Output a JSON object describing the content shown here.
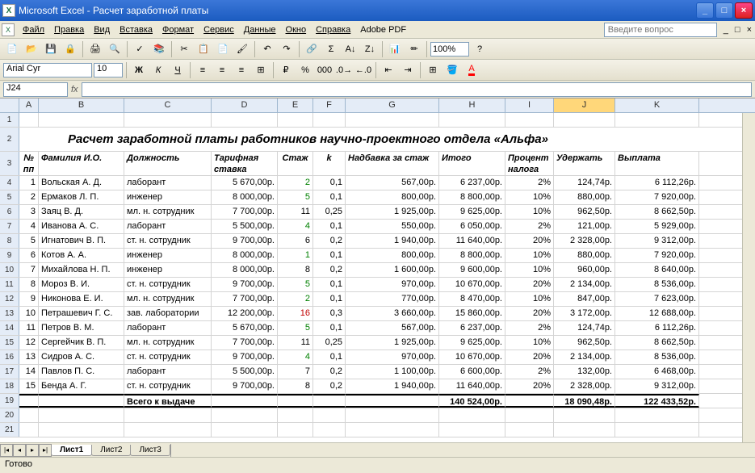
{
  "app": {
    "title": "Microsoft Excel - Расчет заработной платы"
  },
  "menu": {
    "file": "Файл",
    "edit": "Правка",
    "view": "Вид",
    "insert": "Вставка",
    "format": "Формат",
    "tools": "Сервис",
    "data": "Данные",
    "window": "Окно",
    "help": "Справка",
    "adobe": "Adobe PDF"
  },
  "ask": {
    "placeholder": "Введите вопрос"
  },
  "toolbar": {
    "zoom": "100%"
  },
  "format": {
    "font": "Arial Cyr",
    "size": "10"
  },
  "formula": {
    "namebox": "J24",
    "fx": "fx",
    "value": ""
  },
  "columns": [
    "A",
    "B",
    "C",
    "D",
    "E",
    "F",
    "G",
    "H",
    "I",
    "J",
    "K"
  ],
  "sheet": {
    "title": "Расчет заработной платы работников научно-проектного отдела «Альфа»",
    "headers": {
      "n": "№ пп",
      "fio": "Фамилия И.О.",
      "pos": "Должность",
      "rate": "Тарифная ставка",
      "exp": "Стаж",
      "k": "k",
      "bonus": "Надбавка за стаж",
      "total": "Итого",
      "tax": "Процент налога",
      "hold": "Удержать",
      "pay": "Выплата"
    },
    "rows": [
      {
        "n": "1",
        "fio": "Вольская А. Д.",
        "pos": "лаборант",
        "rate": "5 670,00р.",
        "exp": "2",
        "k": "0,1",
        "bonus": "567,00р.",
        "total": "6 237,00р.",
        "tax": "2%",
        "hold": "124,74р.",
        "pay": "6 112,26р."
      },
      {
        "n": "2",
        "fio": "Ермаков Л. П.",
        "pos": "инженер",
        "rate": "8 000,00р.",
        "exp": "5",
        "k": "0,1",
        "bonus": "800,00р.",
        "total": "8 800,00р.",
        "tax": "10%",
        "hold": "880,00р.",
        "pay": "7 920,00р."
      },
      {
        "n": "3",
        "fio": "Заяц В. Д.",
        "pos": "мл. н. сотрудник",
        "rate": "7 700,00р.",
        "exp": "11",
        "k": "0,25",
        "bonus": "1 925,00р.",
        "total": "9 625,00р.",
        "tax": "10%",
        "hold": "962,50р.",
        "pay": "8 662,50р."
      },
      {
        "n": "4",
        "fio": "Иванова А. С.",
        "pos": "лаборант",
        "rate": "5 500,00р.",
        "exp": "4",
        "k": "0,1",
        "bonus": "550,00р.",
        "total": "6 050,00р.",
        "tax": "2%",
        "hold": "121,00р.",
        "pay": "5 929,00р."
      },
      {
        "n": "5",
        "fio": "Игнатович В. П.",
        "pos": "ст. н. сотрудник",
        "rate": "9 700,00р.",
        "exp": "6",
        "k": "0,2",
        "bonus": "1 940,00р.",
        "total": "11 640,00р.",
        "tax": "20%",
        "hold": "2 328,00р.",
        "pay": "9 312,00р."
      },
      {
        "n": "6",
        "fio": "Котов А. А.",
        "pos": "инженер",
        "rate": "8 000,00р.",
        "exp": "1",
        "k": "0,1",
        "bonus": "800,00р.",
        "total": "8 800,00р.",
        "tax": "10%",
        "hold": "880,00р.",
        "pay": "7 920,00р."
      },
      {
        "n": "7",
        "fio": "Михайлова Н. П.",
        "pos": "инженер",
        "rate": "8 000,00р.",
        "exp": "8",
        "k": "0,2",
        "bonus": "1 600,00р.",
        "total": "9 600,00р.",
        "tax": "10%",
        "hold": "960,00р.",
        "pay": "8 640,00р."
      },
      {
        "n": "8",
        "fio": "Мороз В. И.",
        "pos": "ст. н. сотрудник",
        "rate": "9 700,00р.",
        "exp": "5",
        "k": "0,1",
        "bonus": "970,00р.",
        "total": "10 670,00р.",
        "tax": "20%",
        "hold": "2 134,00р.",
        "pay": "8 536,00р."
      },
      {
        "n": "9",
        "fio": "Никонова Е. И.",
        "pos": "мл. н. сотрудник",
        "rate": "7 700,00р.",
        "exp": "2",
        "k": "0,1",
        "bonus": "770,00р.",
        "total": "8 470,00р.",
        "tax": "10%",
        "hold": "847,00р.",
        "pay": "7 623,00р."
      },
      {
        "n": "10",
        "fio": "Петрашевич Г. С.",
        "pos": "зав. лаборатории",
        "rate": "12 200,00р.",
        "exp": "16",
        "k": "0,3",
        "bonus": "3 660,00р.",
        "total": "15 860,00р.",
        "tax": "20%",
        "hold": "3 172,00р.",
        "pay": "12 688,00р."
      },
      {
        "n": "11",
        "fio": "Петров В. М.",
        "pos": "лаборант",
        "rate": "5 670,00р.",
        "exp": "5",
        "k": "0,1",
        "bonus": "567,00р.",
        "total": "6 237,00р.",
        "tax": "2%",
        "hold": "124,74р.",
        "pay": "6 112,26р."
      },
      {
        "n": "12",
        "fio": "Сергейчик В. П.",
        "pos": "мл. н. сотрудник",
        "rate": "7 700,00р.",
        "exp": "11",
        "k": "0,25",
        "bonus": "1 925,00р.",
        "total": "9 625,00р.",
        "tax": "10%",
        "hold": "962,50р.",
        "pay": "8 662,50р."
      },
      {
        "n": "13",
        "fio": "Сидров А. С.",
        "pos": "ст. н. сотрудник",
        "rate": "9 700,00р.",
        "exp": "4",
        "k": "0,1",
        "bonus": "970,00р.",
        "total": "10 670,00р.",
        "tax": "20%",
        "hold": "2 134,00р.",
        "pay": "8 536,00р."
      },
      {
        "n": "14",
        "fio": "Павлов П. С.",
        "pos": "лаборант",
        "rate": "5 500,00р.",
        "exp": "7",
        "k": "0,2",
        "bonus": "1 100,00р.",
        "total": "6 600,00р.",
        "tax": "2%",
        "hold": "132,00р.",
        "pay": "6 468,00р."
      },
      {
        "n": "15",
        "fio": "Бенда А. Г.",
        "pos": "ст. н. сотрудник",
        "rate": "9 700,00р.",
        "exp": "8",
        "k": "0,2",
        "bonus": "1 940,00р.",
        "total": "11 640,00р.",
        "tax": "20%",
        "hold": "2 328,00р.",
        "pay": "9 312,00р."
      }
    ],
    "total": {
      "label": "Всего к выдаче",
      "total": "140 524,00р.",
      "hold": "18 090,48р.",
      "pay": "122 433,52р."
    }
  },
  "tabs": {
    "s1": "Лист1",
    "s2": "Лист2",
    "s3": "Лист3"
  },
  "status": {
    "ready": "Готово"
  }
}
